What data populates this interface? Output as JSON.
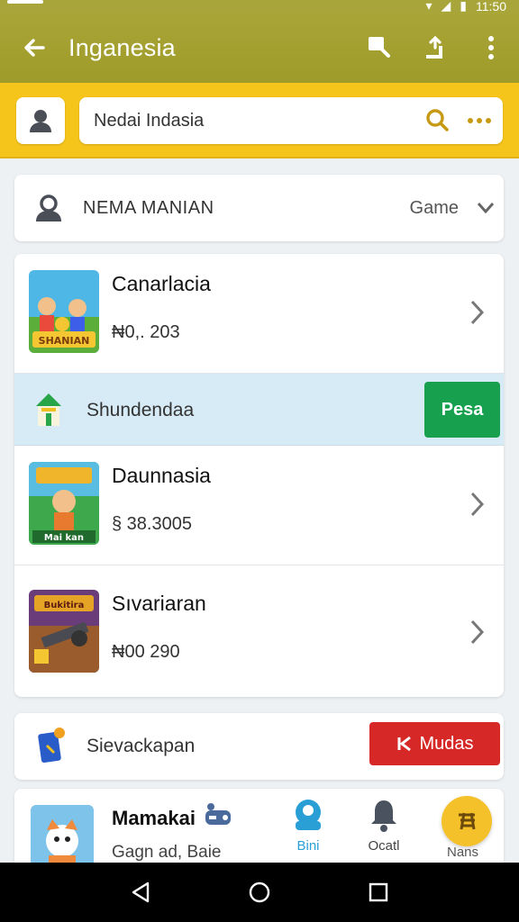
{
  "status": {
    "time": "11:50"
  },
  "appbar": {
    "title": "Inganesia"
  },
  "search": {
    "value": "Nedai Indasia"
  },
  "header": {
    "title": "NEMA  MANIAN",
    "action": "Game"
  },
  "games": [
    {
      "name": "Canarlacia",
      "price": "₦0,. 203",
      "thumb_text": "SHANIAN"
    },
    {
      "name": "Daunnasia",
      "price": "§ 38.3005",
      "thumb_text": "Mai kan"
    },
    {
      "name": "Sıvariaran",
      "price": "₦00 290",
      "thumb_text": "Bukitira"
    }
  ],
  "promo": {
    "label": "Shundendaa",
    "button": "Pesa"
  },
  "special": {
    "label": "Sievackapan",
    "button": "Mudas"
  },
  "bottom_item": {
    "name": "Mamakai",
    "subtitle": "Gagn ad, Baie"
  },
  "bottom_nav": [
    {
      "label": "Bini"
    },
    {
      "label": "Ocatl"
    },
    {
      "label": "Nans"
    }
  ],
  "colors": {
    "appbar": "#a9a537",
    "search_band": "#f5c51c",
    "promo_bg": "#d7ebf6",
    "green": "#17a04e",
    "red": "#d72828",
    "accent_blue": "#2a9fd6"
  }
}
